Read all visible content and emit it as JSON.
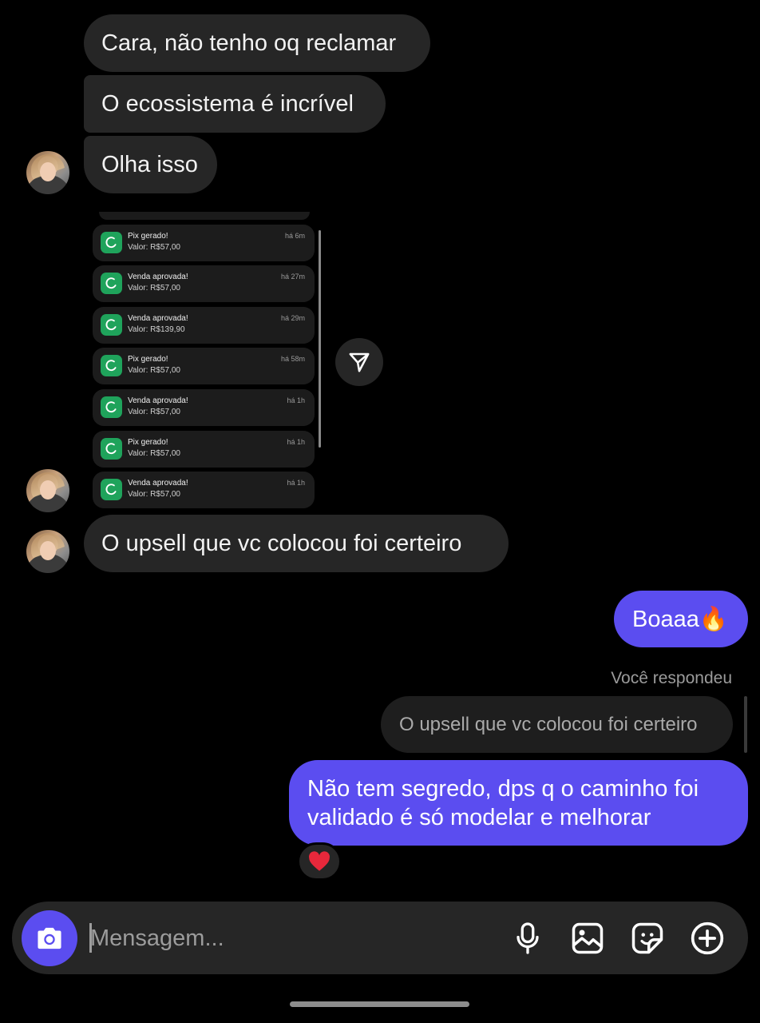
{
  "messages_in": [
    {
      "text": "Cara, não tenho oq reclamar"
    },
    {
      "text": "O ecossistema é incrível"
    },
    {
      "text": "Olha isso"
    },
    {
      "text": "O upsell que vc colocou foi certeiro"
    }
  ],
  "notifications": [
    {
      "title": "Pix gerado!",
      "value": "Valor: R$57,00",
      "time": "há 6m"
    },
    {
      "title": "Venda aprovada!",
      "value": "Valor: R$57,00",
      "time": "há 27m"
    },
    {
      "title": "Venda aprovada!",
      "value": "Valor: R$139,90",
      "time": "há 29m"
    },
    {
      "title": "Pix gerado!",
      "value": "Valor: R$57,00",
      "time": "há 58m"
    },
    {
      "title": "Venda aprovada!",
      "value": "Valor: R$57,00",
      "time": "há 1h"
    },
    {
      "title": "Pix gerado!",
      "value": "Valor: R$57,00",
      "time": "há 1h"
    },
    {
      "title": "Venda aprovada!",
      "value": "Valor: R$57,00",
      "time": "há 1h"
    }
  ],
  "messages_out": {
    "first": "Boaaa🔥",
    "replied_label": "Você respondeu",
    "replied_quote": "O upsell que vc colocou foi certeiro",
    "second_line1": "Não tem segredo, dps q o caminho foi",
    "second_line2": "validado é só modelar e melhorar",
    "reaction": "❤️"
  },
  "composer": {
    "placeholder": "Mensagem..."
  },
  "colors": {
    "accent": "#5b4df0",
    "bubble_in": "#262626",
    "notif_app": "#1fa35b"
  },
  "icons": [
    "camera-icon",
    "microphone-icon",
    "gallery-icon",
    "sticker-icon",
    "plus-circle-icon",
    "send-icon",
    "heart-icon"
  ]
}
